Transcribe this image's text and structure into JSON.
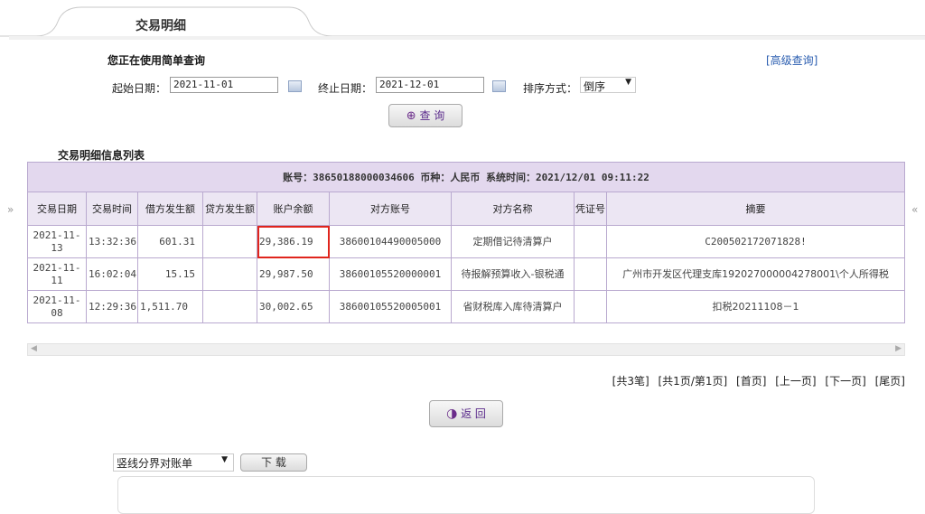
{
  "tab": {
    "title": "交易明细"
  },
  "query": {
    "simple_mode_title": "您正在使用简单查询",
    "advanced_link": "[高级查询]",
    "start_label": "起始日期：",
    "start_value": "2021-11-01",
    "end_label": "终止日期：",
    "end_value": "2021-12-01",
    "sort_label": "排序方式：",
    "sort_value": "倒序",
    "search_button": "查 询"
  },
  "list": {
    "section_title": "交易明细信息列表",
    "account_info": "账号：38650188000034606    币种：人民币    系统时间：2021/12/01 09:11:22",
    "columns": [
      "交易日期",
      "交易时间",
      "借方发生额",
      "贷方发生额",
      "账户余额",
      "对方账号",
      "对方名称",
      "凭证号",
      "摘要"
    ],
    "rows": [
      {
        "date": "2021-11-13",
        "time": "13:32:36",
        "debit": "601.31",
        "credit": "",
        "balance": "29,386.19",
        "counter_account": "38600104490005000",
        "counter_name": "定期借记待清算户",
        "voucher": "",
        "memo": "C200502172071828!"
      },
      {
        "date": "2021-11-11",
        "time": "16:02:04",
        "debit": "15.15",
        "credit": "",
        "balance": "29,987.50",
        "counter_account": "38600105520000001",
        "counter_name": "待报解预算收入-银税通",
        "voucher": "",
        "memo": "广州市开发区代理支库192027000004278001\\个人所得税"
      },
      {
        "date": "2021-11-08",
        "time": "12:29:36",
        "debit": "1,511.70",
        "credit": "",
        "balance": "30,002.65",
        "counter_account": "38600105520005001",
        "counter_name": "省财税库入库待清算户",
        "voucher": "",
        "memo": "扣税20211108－1"
      }
    ]
  },
  "pager": {
    "total": "[共3笔]",
    "page": "[共1页/第1页]",
    "first": "[首页]",
    "prev": "[上一页]",
    "next": "[下一页]",
    "last": "[尾页]"
  },
  "actions": {
    "back_button": "返 回",
    "export_format": "竖线分界对账单",
    "download_button": "下 载"
  },
  "icons": {
    "collapse_left": "»",
    "collapse_right": "«"
  }
}
